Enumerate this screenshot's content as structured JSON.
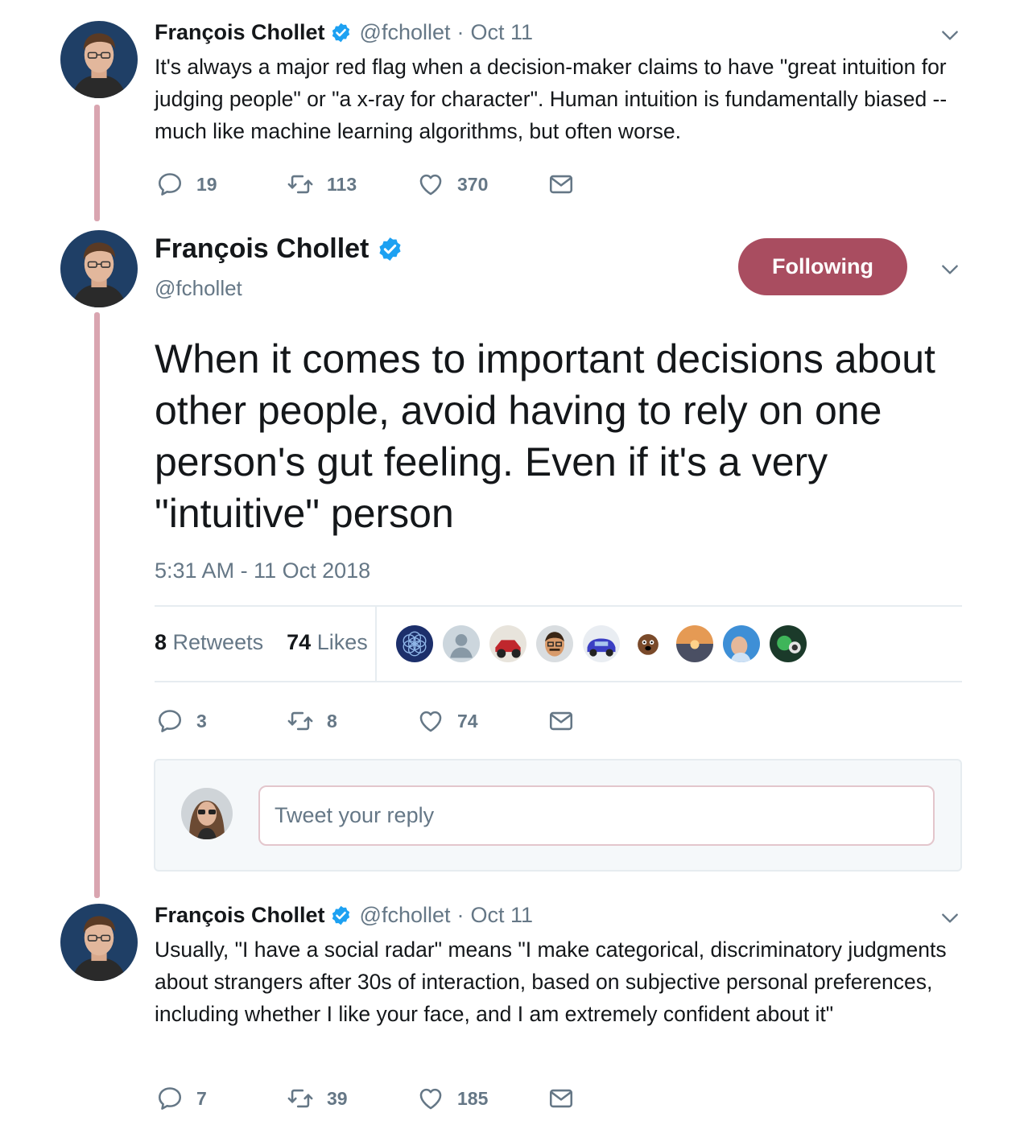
{
  "colors": {
    "thread_line": "#d9a5b0",
    "follow_button": "#a94d60",
    "verified": "#1da1f2",
    "muted": "#657786",
    "text": "#14171a"
  },
  "tweet1": {
    "name": "François Chollet",
    "handle": "@fchollet",
    "separator": "·",
    "date": "Oct 11",
    "text": "It's always a major red flag when a decision-maker claims to have \"great intuition for judging people\" or \"a x-ray for character\". Human intuition is fundamentally biased -- much like machine learning algorithms, but often worse.",
    "replies": "19",
    "retweets": "113",
    "likes": "370"
  },
  "main_tweet": {
    "name": "François Chollet",
    "handle": "@fchollet",
    "follow_label": "Following",
    "text": "When it comes to important decisions about other people, avoid having to rely on one person's gut feeling. Even if it's a very \"intuitive\" person",
    "timestamp": "5:31 AM - 11 Oct 2018",
    "retweet_count": "8",
    "retweet_label": "Retweets",
    "like_count": "74",
    "like_label": "Likes",
    "replies": "3",
    "retweets": "8",
    "likes": "74"
  },
  "reply": {
    "placeholder": "Tweet your reply"
  },
  "tweet3": {
    "name": "François Chollet",
    "handle": "@fchollet",
    "separator": "·",
    "date": "Oct 11",
    "text": "Usually, \"I have a social radar\" means \"I make categorical, discriminatory judgments about strangers after 30s of interaction, based on subjective personal preferences, including whether I like your face, and I am extremely confident about it\"",
    "replies": "7",
    "retweets": "39",
    "likes": "185"
  },
  "icons": [
    "reply-icon",
    "retweet-icon",
    "like-icon",
    "message-icon",
    "verified-icon",
    "chevron-down-icon"
  ]
}
